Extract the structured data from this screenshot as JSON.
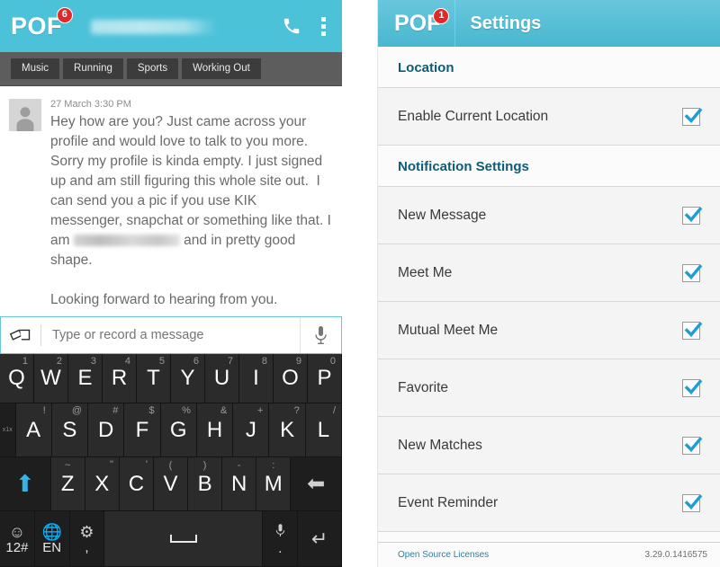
{
  "colors": {
    "teal_header": "#4cc2d9",
    "teal_header_gradient_top": "#68c7dc",
    "teal_header_gradient_bottom": "#49b7d0",
    "badge_red": "#e02a2a",
    "section_header_blue": "#0d5c78",
    "checkbox_check_blue": "#1e9ed6",
    "shift_key_blue": "#33b5e5",
    "footer_link_blue": "#2f7f9e",
    "input_border_blue": "#69c6dc"
  },
  "chat": {
    "brand": "POF",
    "badge_count": "6",
    "peer_name_redacted": "",
    "icons": {
      "call": "phone-icon",
      "overflow": "overflow-menu-icon"
    },
    "tabs": [
      {
        "label": "Music"
      },
      {
        "label": "Running"
      },
      {
        "label": "Sports"
      },
      {
        "label": "Working Out"
      }
    ],
    "message": {
      "timestamp": "27 March 3:30 PM",
      "part1": "Hey how are you? Just came across your profile and would love to talk to you more. Sorry my profile is kinda empty. I just signed up and am still figuring this whole site out.  I can send you a pic if you use KIK messenger, snapchat or something like that. I am ",
      "part2": " and in pretty good shape.",
      "part3": "Looking forward to hearing from you."
    },
    "input": {
      "placeholder": "Type or record a message",
      "value": "",
      "attach_icon": "cards-icon",
      "mic_icon": "microphone-icon"
    }
  },
  "keyboard": {
    "row1": [
      {
        "key": "Q",
        "sub": "1"
      },
      {
        "key": "W",
        "sub": "2"
      },
      {
        "key": "E",
        "sub": "3"
      },
      {
        "key": "R",
        "sub": "4"
      },
      {
        "key": "T",
        "sub": "5"
      },
      {
        "key": "Y",
        "sub": "6"
      },
      {
        "key": "U",
        "sub": "7"
      },
      {
        "key": "I",
        "sub": "8"
      },
      {
        "key": "O",
        "sub": "9"
      },
      {
        "key": "P",
        "sub": "0"
      }
    ],
    "row2_side": "x1x",
    "row2": [
      {
        "key": "A",
        "sub": "!"
      },
      {
        "key": "S",
        "sub": "@"
      },
      {
        "key": "D",
        "sub": "#"
      },
      {
        "key": "F",
        "sub": "$"
      },
      {
        "key": "G",
        "sub": "%"
      },
      {
        "key": "H",
        "sub": "&"
      },
      {
        "key": "J",
        "sub": "+"
      },
      {
        "key": "K",
        "sub": "?"
      },
      {
        "key": "L",
        "sub": "/"
      }
    ],
    "row3": [
      {
        "key": "Z",
        "sub": "~"
      },
      {
        "key": "X",
        "sub": "\""
      },
      {
        "key": "C",
        "sub": "'"
      },
      {
        "key": "V",
        "sub": "("
      },
      {
        "key": "B",
        "sub": ")"
      },
      {
        "key": "N",
        "sub": "-"
      },
      {
        "key": "M",
        "sub": ":"
      }
    ],
    "shift_label": "shift-key",
    "backspace_label": "backspace-key",
    "row4": {
      "emoji_glyph": "☺",
      "emoji_label": "12#",
      "globe_glyph": "🌐",
      "globe_label": "EN",
      "gear_glyph": "⚙",
      "gear_label": ",",
      "space_label": "",
      "mic_label": ".",
      "enter_glyph": "↵"
    }
  },
  "settings": {
    "brand": "POF",
    "badge_count": "1",
    "title": "Settings",
    "sections": [
      {
        "header": "Location",
        "rows": [
          {
            "label": "Enable Current Location",
            "checked": true
          }
        ]
      },
      {
        "header": "Notification Settings",
        "rows": [
          {
            "label": "New Message",
            "checked": true
          },
          {
            "label": "Meet Me",
            "checked": true
          },
          {
            "label": "Mutual Meet Me",
            "checked": true
          },
          {
            "label": "Favorite",
            "checked": true
          },
          {
            "label": "New Matches",
            "checked": true
          },
          {
            "label": "Event Reminder",
            "checked": true
          }
        ]
      }
    ],
    "footer": {
      "link": "Open Source Licenses",
      "version": "3.29.0.1416575"
    }
  }
}
